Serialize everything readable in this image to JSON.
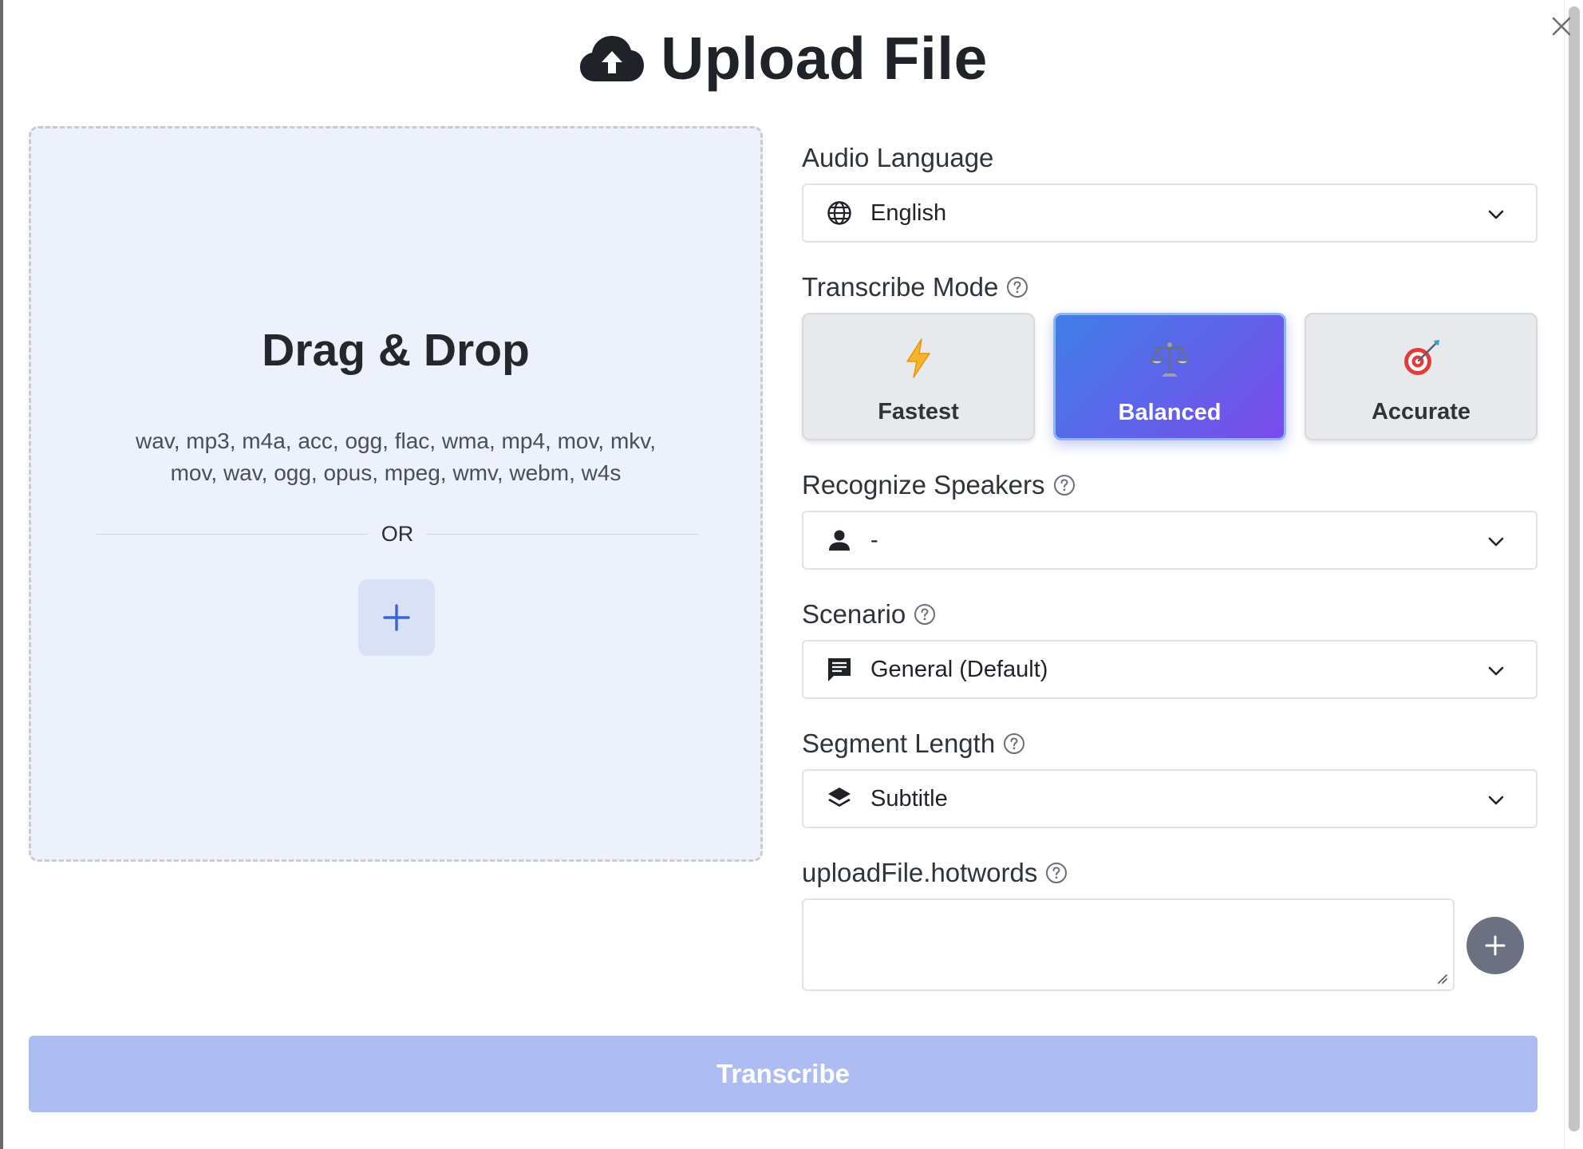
{
  "dialog": {
    "title": "Upload File",
    "close_icon": "close-icon",
    "title_icon": "cloud-upload-icon"
  },
  "dropzone": {
    "title": "Drag & Drop",
    "formats_line1": "wav, mp3, m4a, acc, ogg, flac, wma, mp4, mov, mkv,",
    "formats_line2": "mov, wav, ogg, opus, mpeg, wmv, webm, w4s",
    "or_text": "OR",
    "add_icon": "plus-icon"
  },
  "form": {
    "audio_language": {
      "label": "Audio Language",
      "value": "English",
      "icon": "globe-icon"
    },
    "transcribe_mode": {
      "label": "Transcribe Mode",
      "options": [
        {
          "label": "Fastest",
          "icon": "⚡"
        },
        {
          "label": "Balanced",
          "icon": "⚖️"
        },
        {
          "label": "Accurate",
          "icon": "🎯"
        }
      ],
      "selected": "Balanced"
    },
    "recognize_speakers": {
      "label": "Recognize Speakers",
      "value": "-",
      "icon": "person-icon"
    },
    "scenario": {
      "label": "Scenario",
      "value": "General (Default)",
      "icon": "message-icon"
    },
    "segment_length": {
      "label": "Segment Length",
      "value": "Subtitle",
      "icon": "layers-icon"
    },
    "hotwords": {
      "label": "uploadFile.hotwords",
      "value": ""
    }
  },
  "actions": {
    "transcribe_label": "Transcribe"
  },
  "colors": {
    "accent_gradient_start": "#3f7ee8",
    "accent_gradient_end": "#7c4bea",
    "transcribe_disabled": "#adbdf2",
    "dropzone_bg": "#edf1fc"
  }
}
